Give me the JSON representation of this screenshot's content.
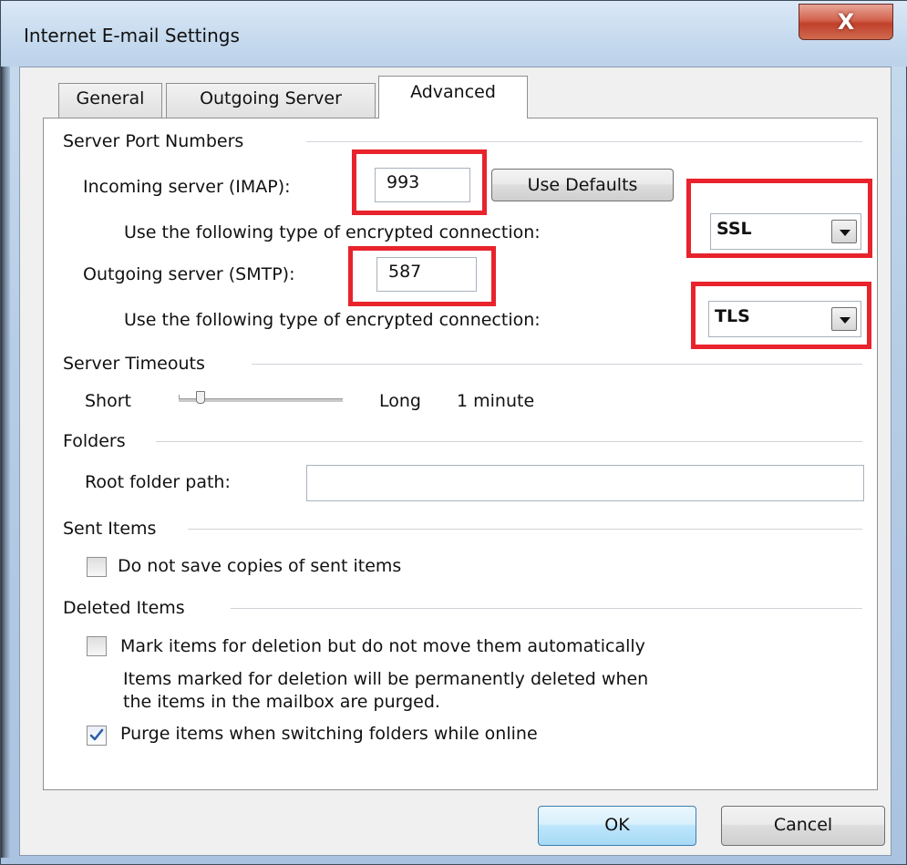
{
  "window": {
    "title": "Internet E-mail Settings",
    "close_glyph": "X"
  },
  "tabs": [
    {
      "label": "General"
    },
    {
      "label": "Outgoing Server"
    },
    {
      "label": "Advanced"
    }
  ],
  "server_ports": {
    "group_label": "Server Port Numbers",
    "incoming_label": "Incoming server (IMAP):",
    "incoming_value": "993",
    "use_defaults_label": "Use Defaults",
    "incoming_encryption_label": "Use the following type of encrypted connection:",
    "incoming_encryption_value": "SSL",
    "outgoing_label": "Outgoing server (SMTP):",
    "outgoing_value": "587",
    "outgoing_encryption_label": "Use the following type of encrypted connection:",
    "outgoing_encryption_value": "TLS"
  },
  "timeouts": {
    "group_label": "Server Timeouts",
    "short_label": "Short",
    "long_label": "Long",
    "value_label": "1 minute"
  },
  "folders": {
    "group_label": "Folders",
    "root_label": "Root folder path:",
    "root_value": ""
  },
  "sent_items": {
    "group_label": "Sent Items",
    "do_not_save_label": "Do not save copies of sent items",
    "do_not_save_checked": false
  },
  "deleted_items": {
    "group_label": "Deleted Items",
    "mark_label": "Mark items for deletion but do not move them automatically",
    "mark_checked": false,
    "mark_note_line1": "Items marked for deletion will be permanently deleted when",
    "mark_note_line2": "the items in the mailbox are purged.",
    "purge_label": "Purge items when switching folders while online",
    "purge_checked": true
  },
  "buttons": {
    "ok": "OK",
    "cancel": "Cancel"
  },
  "colors": {
    "highlight": "#e8232c",
    "check": "#2d5fa8"
  }
}
